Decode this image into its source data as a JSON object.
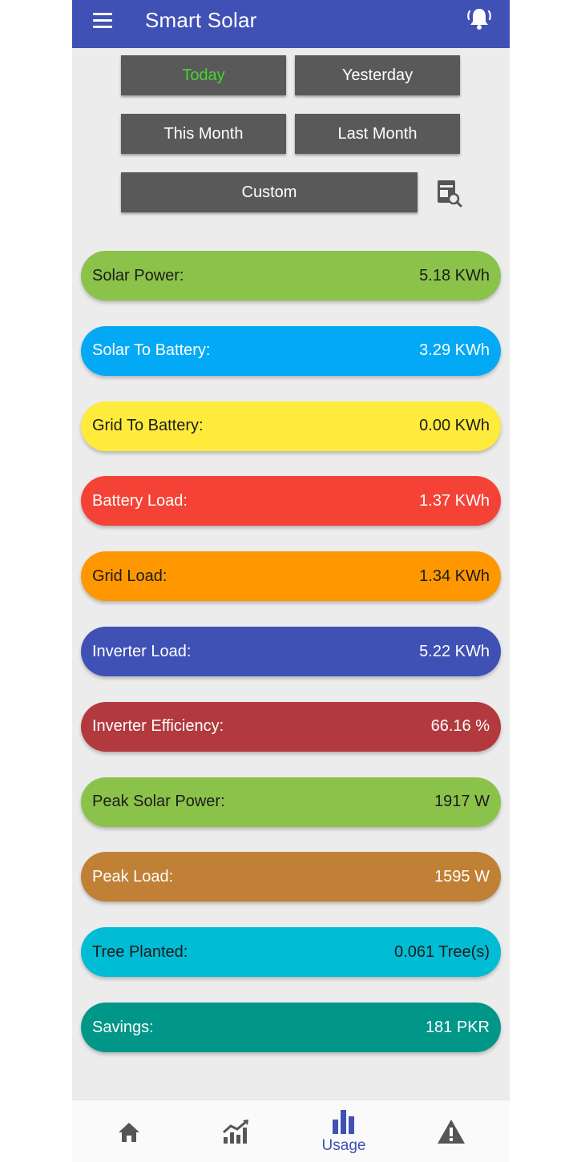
{
  "app": {
    "title": "Smart Solar"
  },
  "header": {
    "menu_icon": "hamburger-menu-icon",
    "bell_icon": "bell-alert-icon"
  },
  "filters": {
    "today": "Today",
    "yesterday": "Yesterday",
    "this_month": "This Month",
    "last_month": "Last Month",
    "custom": "Custom",
    "calendar_icon": "calendar-search-icon"
  },
  "stats": [
    {
      "label": "Solar Power:",
      "value": "5.18 KWh",
      "color": "#8bc34a"
    },
    {
      "label": "Solar To Battery:",
      "value": "3.29 KWh",
      "color": "#03a9f4"
    },
    {
      "label": "Grid To Battery:",
      "value": "0.00 KWh",
      "color": "#ffeb3b"
    },
    {
      "label": "Battery Load:",
      "value": "1.37 KWh",
      "color": "#f44336"
    },
    {
      "label": "Grid Load:",
      "value": "1.34 KWh",
      "color": "#ff9800"
    },
    {
      "label": "Inverter Load:",
      "value": "5.22 KWh",
      "color": "#3f51b5"
    },
    {
      "label": "Inverter Efficiency:",
      "value": "66.16 %",
      "color": "#b23a3e"
    },
    {
      "label": "Peak Solar Power:",
      "value": "1917 W",
      "color": "#8bc34a"
    },
    {
      "label": "Peak Load:",
      "value": "1595 W",
      "color": "#c08035"
    },
    {
      "label": "Tree Planted:",
      "value": "0.061 Tree(s)",
      "color": "#00bcd4"
    },
    {
      "label": "Savings:",
      "value": "181 PKR",
      "color": "#009688"
    }
  ],
  "bottom_nav": {
    "home_icon": "home-icon",
    "trend_icon": "chart-trend-icon",
    "usage_icon": "bar-chart-icon",
    "usage_label": "Usage",
    "alert_icon": "warning-icon"
  },
  "colors": {
    "primary": "#3f51b5",
    "active_filter_text": "#44d62c",
    "filter_button": "#595959"
  }
}
